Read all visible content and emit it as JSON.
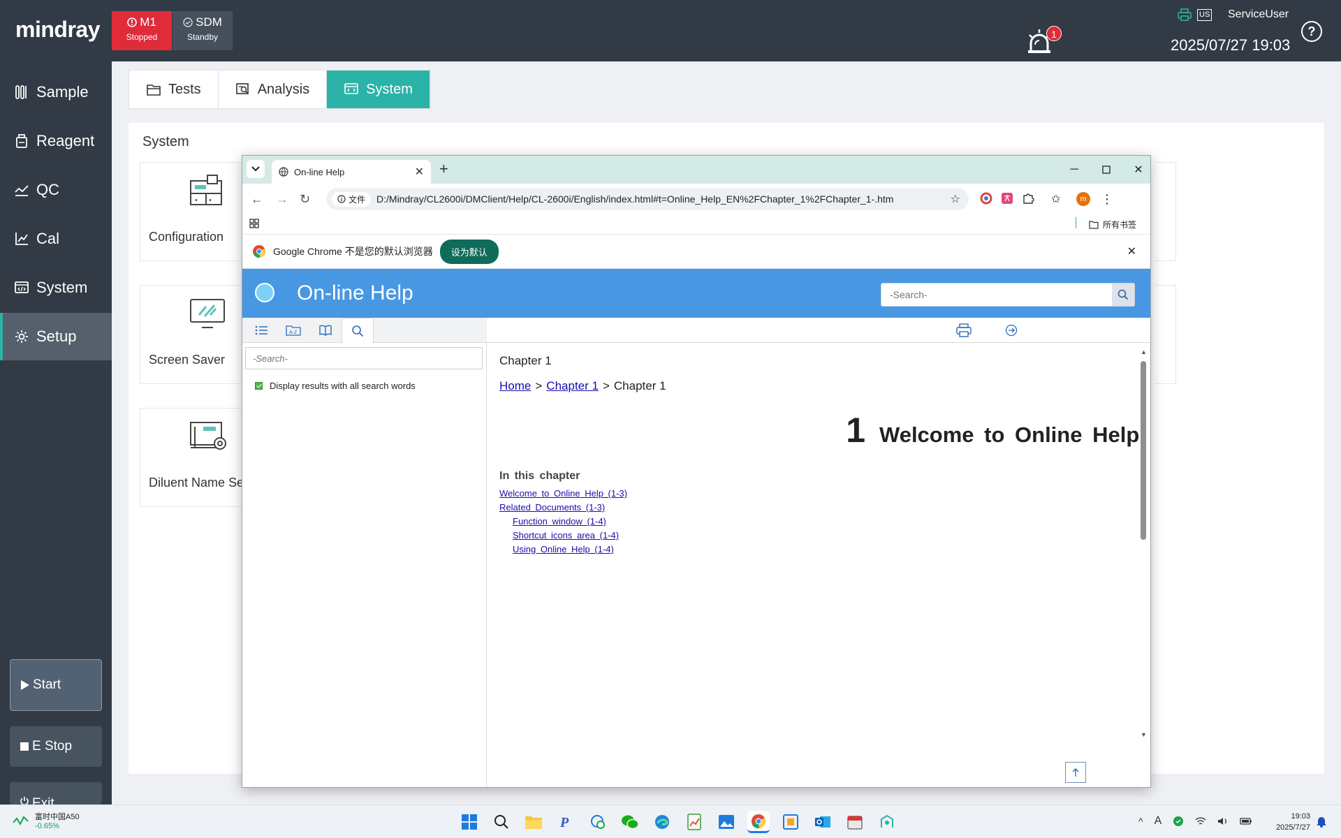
{
  "app": {
    "logo": "mindray",
    "modules": [
      {
        "name": "M1",
        "status": "Stopped"
      },
      {
        "name": "SDM",
        "status": "Standby"
      }
    ],
    "alarm_count": "1",
    "lang_badge": "US",
    "user": "ServiceUser",
    "datetime": "2025/07/27 19:03",
    "help_symbol": "?",
    "colors": {
      "accent": "#2ab3a6",
      "header": "#323b45",
      "alert": "#e02b3a"
    }
  },
  "sidebar": {
    "items": [
      {
        "label": "Sample",
        "icon": "sample-tubes-icon"
      },
      {
        "label": "Reagent",
        "icon": "reagent-bottle-icon"
      },
      {
        "label": "QC",
        "icon": "qc-chart-icon"
      },
      {
        "label": "Cal",
        "icon": "calibration-chart-icon"
      },
      {
        "label": "System",
        "icon": "system-monitor-icon"
      },
      {
        "label": "Setup",
        "icon": "gear-icon"
      }
    ],
    "active": "Setup",
    "start_label": "Start",
    "estop_label": "E Stop",
    "exit_label": "Exit"
  },
  "tabs": [
    {
      "label": "Tests",
      "active": false
    },
    {
      "label": "Analysis",
      "active": false
    },
    {
      "label": "System",
      "active": true
    }
  ],
  "system_panel": {
    "title": "System",
    "cards": [
      {
        "label": "Configuration"
      },
      {
        "label": "Screen Saver"
      },
      {
        "label": "Diluent Name Se"
      }
    ]
  },
  "browser": {
    "tab_title": "On-line Help",
    "file_chip": "文件",
    "url": "D:/Mindray/CL2600i/DMClient/Help/CL-2600i/English/index.html#t=Online_Help_EN%2FChapter_1%2FChapter_1-.htm",
    "profile_letter": "m",
    "bookmarks_label": "所有书签",
    "infobar_text": "Google Chrome 不是您的默认浏览器",
    "infobar_button": "设为默认"
  },
  "help": {
    "title": "On-line Help",
    "search_placeholder": "-Search-",
    "pane_search_placeholder": "-Search-",
    "search_option": "Display results with all search words",
    "page_heading": "Chapter 1",
    "breadcrumb": {
      "home": "Home",
      "chapter": "Chapter 1",
      "current": "Chapter 1",
      "sep": ">"
    },
    "chapter_number": "1",
    "chapter_title": "Welcome to Online Help",
    "in_this_chapter": "In this chapter",
    "toc": [
      {
        "label": "Welcome to Online Help (1-3)",
        "sub": false
      },
      {
        "label": "Related Documents (1-3)",
        "sub": false
      },
      {
        "label": "Function window (1-4)",
        "sub": true
      },
      {
        "label": "Shortcut icons area (1-4)",
        "sub": true
      },
      {
        "label": "Using Online Help (1-4)",
        "sub": true
      }
    ]
  },
  "taskbar": {
    "stock_name": "富时中国A50",
    "stock_change": "-0.65%",
    "time": "19:03",
    "date": "2025/7/27",
    "ime": "A"
  }
}
